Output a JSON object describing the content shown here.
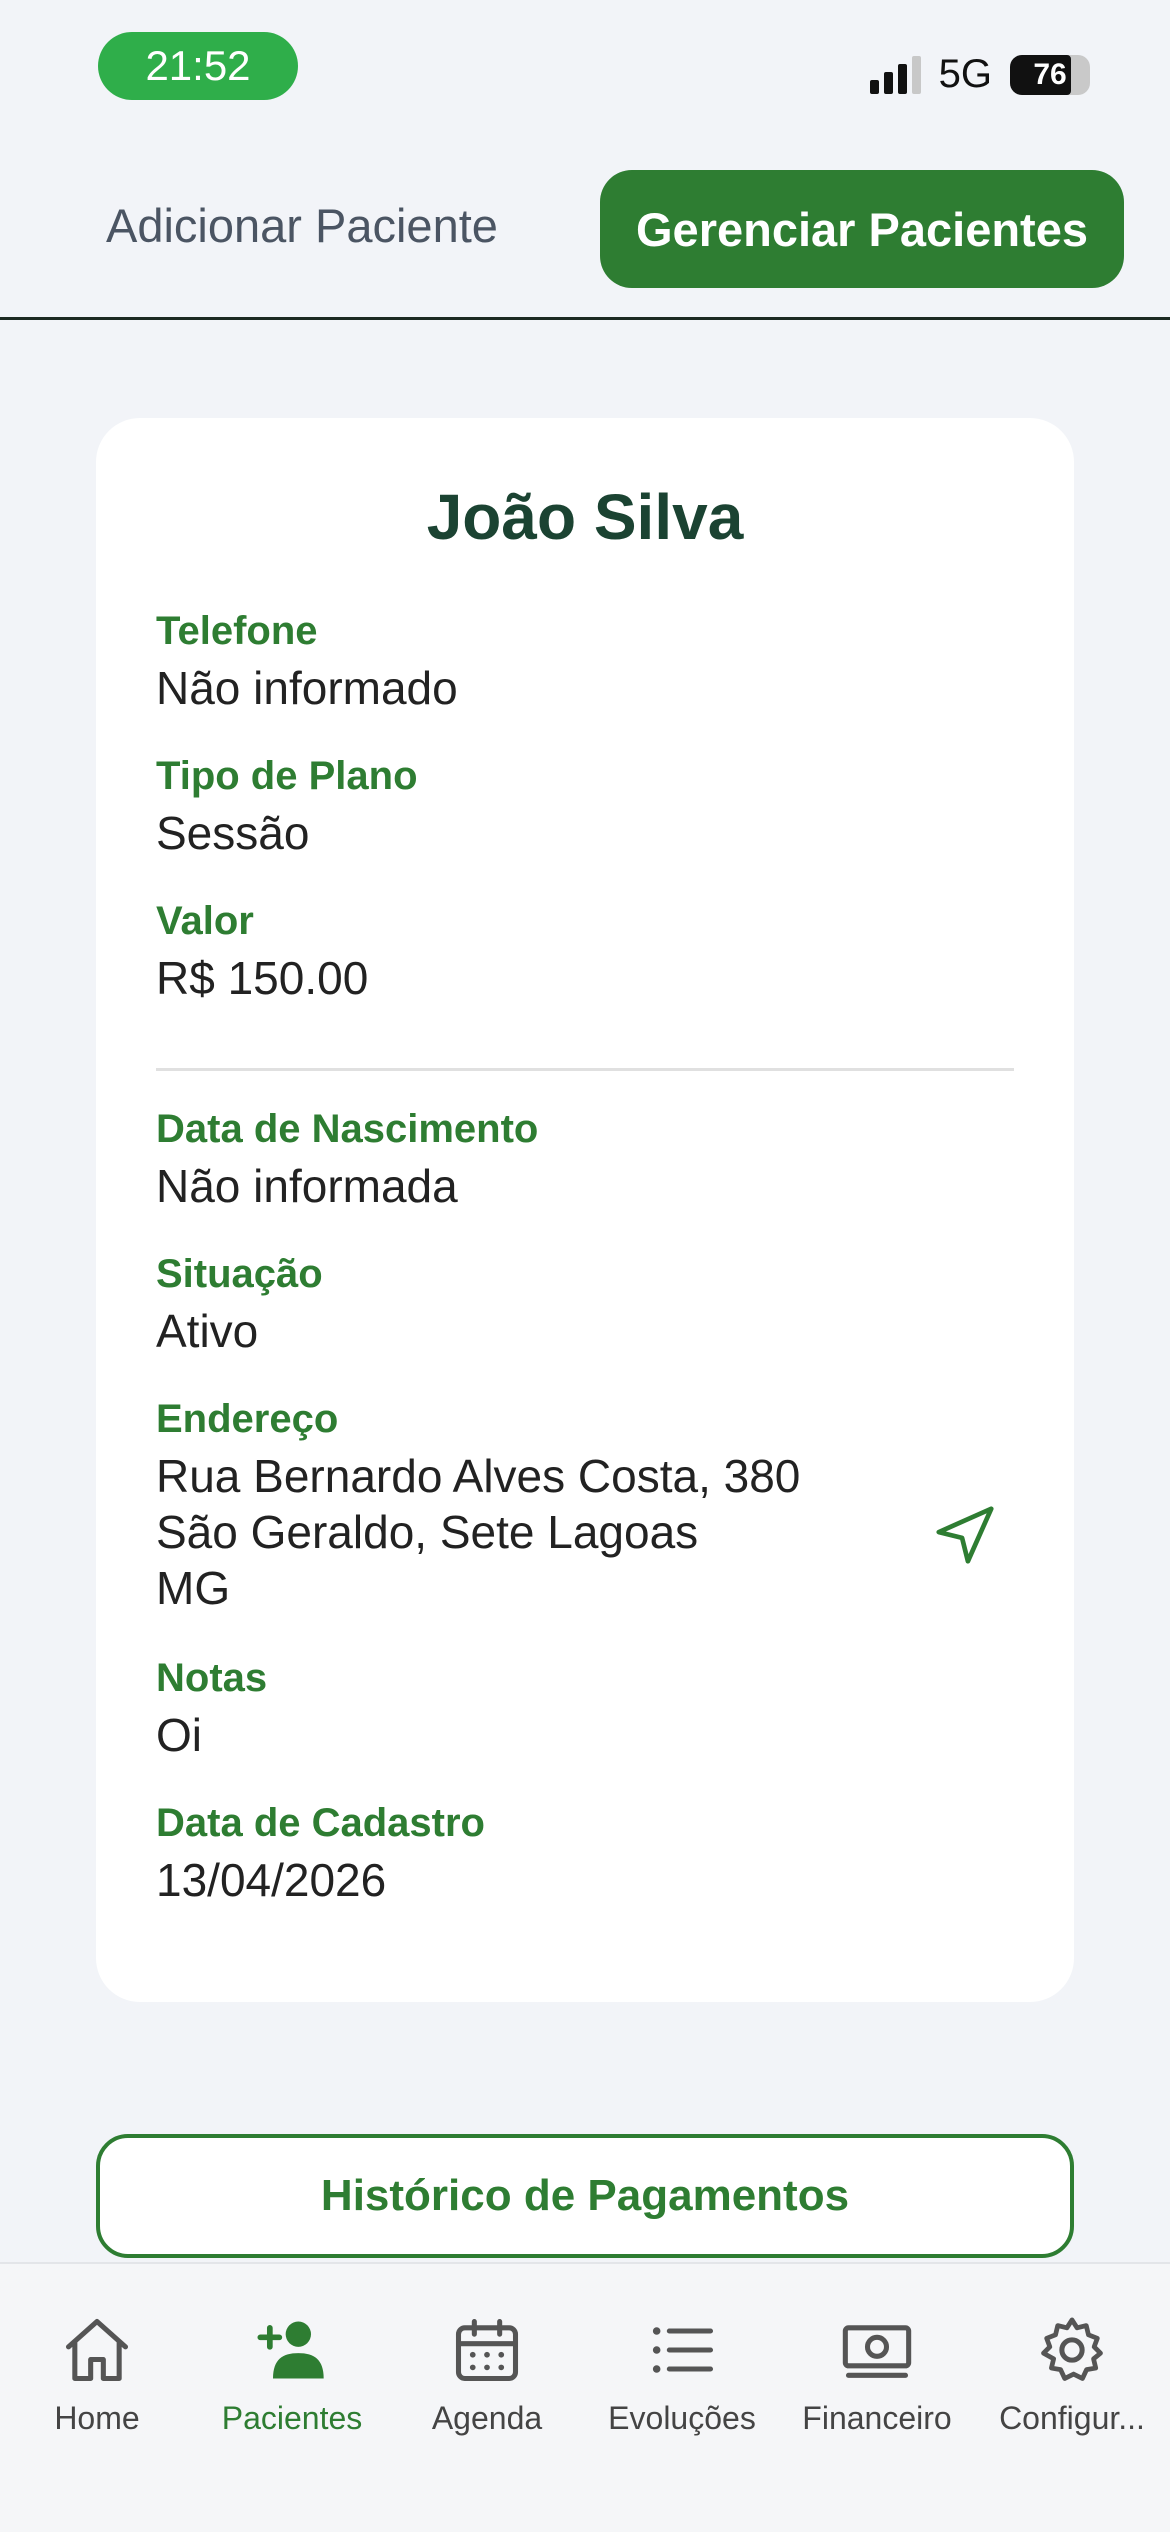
{
  "status_bar": {
    "time": "21:52",
    "network": "5G",
    "battery": "76"
  },
  "tabs": {
    "add_patient": "Adicionar Paciente",
    "manage_patients": "Gerenciar Pacientes"
  },
  "patient": {
    "name": "João Silva",
    "fields": [
      {
        "label": "Telefone",
        "value": "Não informado"
      },
      {
        "label": "Tipo de Plano",
        "value": "Sessão"
      },
      {
        "label": "Valor",
        "value": "R$ 150.00"
      },
      {
        "label": "Data de Nascimento",
        "value": "Não informada"
      },
      {
        "label": "Situação",
        "value": "Ativo"
      },
      {
        "label": "Endereço",
        "value_lines": [
          "Rua Bernardo Alves Costa, 380",
          "São Geraldo, Sete Lagoas",
          "MG"
        ]
      },
      {
        "label": "Notas",
        "value": "Oi"
      },
      {
        "label": "Data de Cadastro",
        "value": "13/04/2026"
      }
    ]
  },
  "history_button": "Histórico de Pagamentos",
  "bottom_nav": [
    {
      "label": "Home",
      "icon": "home-icon"
    },
    {
      "label": "Pacientes",
      "icon": "add-person-icon",
      "active": true
    },
    {
      "label": "Agenda",
      "icon": "calendar-icon"
    },
    {
      "label": "Evoluções",
      "icon": "list-icon"
    },
    {
      "label": "Financeiro",
      "icon": "money-icon"
    },
    {
      "label": "Configur...",
      "icon": "gear-icon"
    }
  ],
  "colors": {
    "accent": "#2e7d32",
    "status_pill": "#2fae4a",
    "title": "#1b4332"
  }
}
